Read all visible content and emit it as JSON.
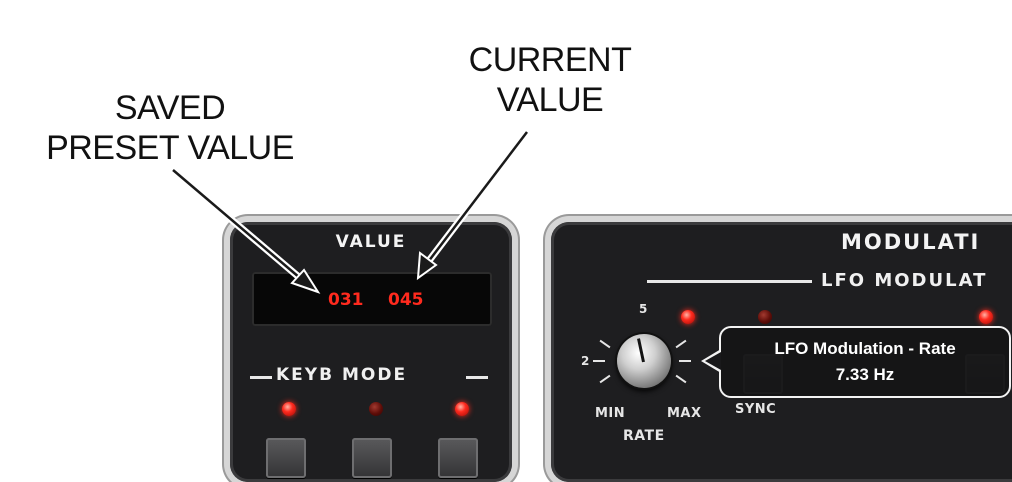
{
  "callouts": {
    "saved_line1": "SAVED",
    "saved_line2": "PRESET VALUE",
    "current_line1": "CURRENT",
    "current_line2": "VALUE"
  },
  "value_panel": {
    "title": "VALUE",
    "saved_value": "031",
    "current_value": "045",
    "keyb_mode_label": "KEYB MODE",
    "leds": [
      "on",
      "off",
      "on"
    ]
  },
  "modulation_panel": {
    "title": "MODULATI",
    "lfo_label": "LFO MODULAT",
    "knob": {
      "tick_2": "2",
      "tick_5": "5",
      "min_label": "MIN",
      "max_label": "MAX",
      "rate_label": "RATE"
    },
    "sync_label": "SYNC",
    "tooltip": {
      "title": "LFO Modulation - Rate",
      "value": "7.33 Hz"
    }
  },
  "colors": {
    "led_on": "#ff2a1e",
    "display_digits": "#ff2a1e",
    "panel_bg": "#1e1e20"
  }
}
